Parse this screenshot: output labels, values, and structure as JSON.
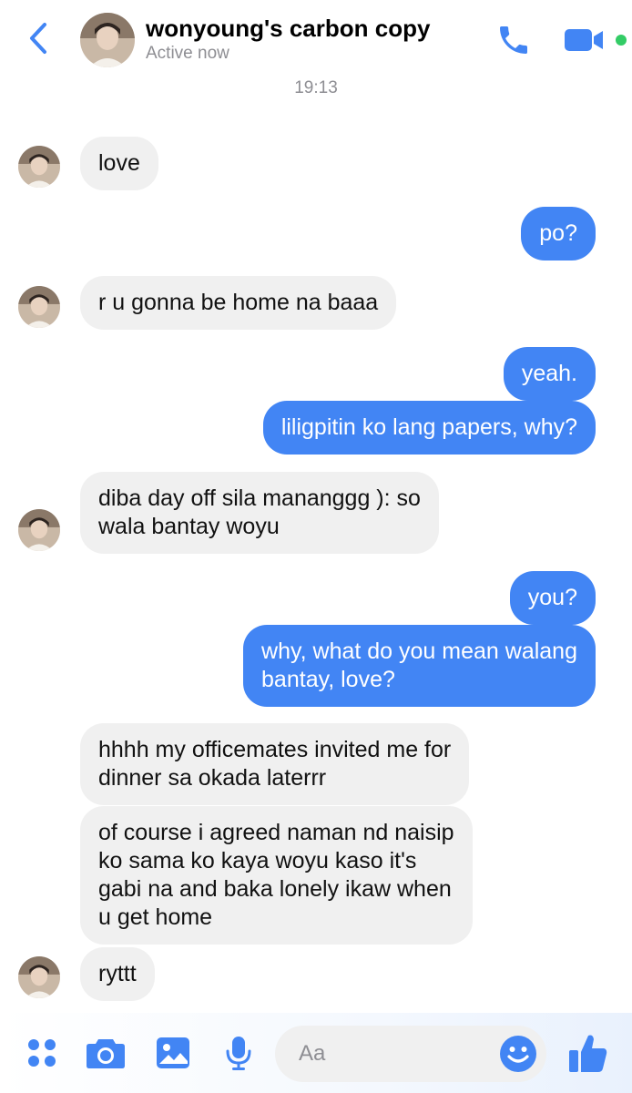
{
  "header": {
    "chat_name": "wonyoung's carbon copy",
    "status": "Active now"
  },
  "timestamp": "19:13",
  "colors": {
    "accent": "#4285f4",
    "incoming_bubble": "#f0f0f0",
    "online": "#33cc66"
  },
  "messages": [
    {
      "side": "in",
      "text": "love"
    },
    {
      "side": "out",
      "text": "po?"
    },
    {
      "side": "in",
      "text": "r u gonna be home na baaa"
    },
    {
      "side": "out",
      "text": "yeah."
    },
    {
      "side": "out",
      "text": "liligpitin ko lang papers, why?"
    },
    {
      "side": "in",
      "text": "diba day off sila mananggg ): so\nwala bantay woyu"
    },
    {
      "side": "out",
      "text": "you?"
    },
    {
      "side": "out",
      "text": "why, what do you mean walang\nbantay, love?"
    },
    {
      "side": "in",
      "text": "hhhh my officemates invited me for\ndinner sa okada laterrr"
    },
    {
      "side": "in",
      "text": "of course i agreed naman nd naisip\nko sama ko kaya woyu kaso it's\ngabi na and baka lonely ikaw when\nu get home"
    },
    {
      "side": "in",
      "text": "ryttt"
    }
  ],
  "composer": {
    "placeholder": "Aa",
    "icons": [
      "apps-icon",
      "camera-icon",
      "gallery-icon",
      "microphone-icon",
      "emoji-icon",
      "thumbs-up-icon"
    ]
  }
}
